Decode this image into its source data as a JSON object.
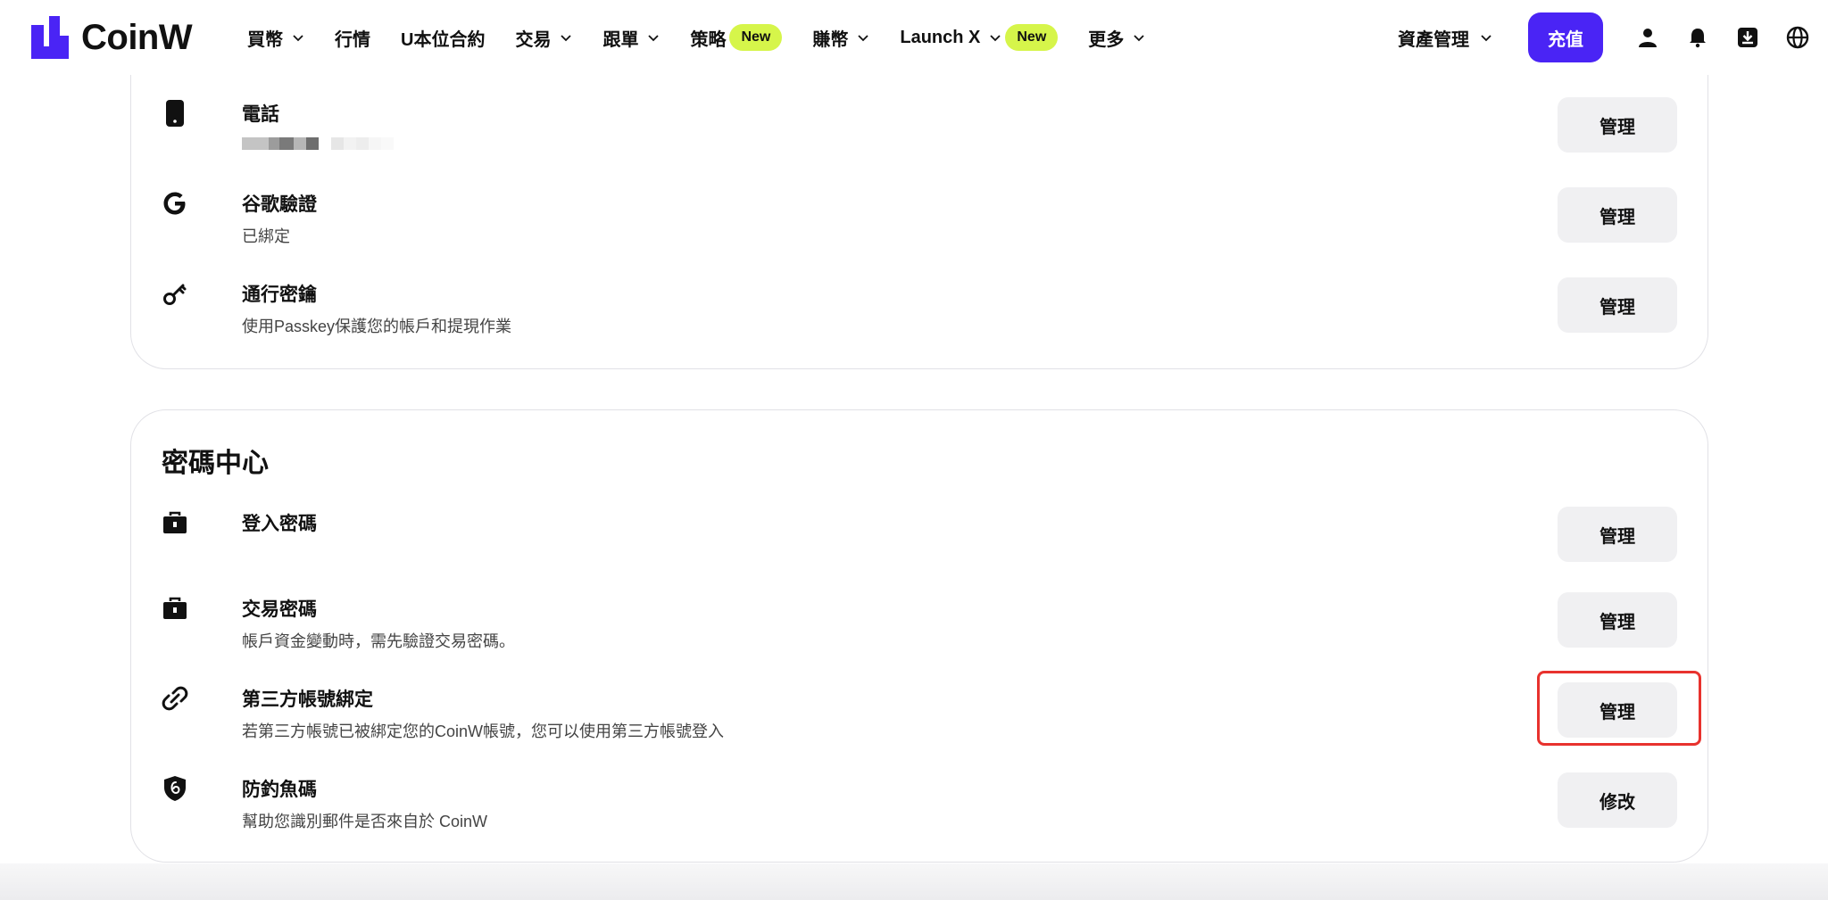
{
  "header": {
    "logo_text": "CoinW",
    "nav": [
      {
        "label": "買幣",
        "has_dropdown": true
      },
      {
        "label": "行情",
        "has_dropdown": false
      },
      {
        "label": "U本位合約",
        "has_dropdown": false
      },
      {
        "label": "交易",
        "has_dropdown": true
      },
      {
        "label": "跟單",
        "has_dropdown": true
      },
      {
        "label": "策略",
        "has_dropdown": false,
        "badge": "New"
      },
      {
        "label": "賺幣",
        "has_dropdown": true
      },
      {
        "label": "Launch X",
        "has_dropdown": true,
        "badge": "New"
      },
      {
        "label": "更多",
        "has_dropdown": true
      }
    ],
    "asset_management": "資產管理",
    "deposit": "充值",
    "icons": [
      "user-icon",
      "bell-icon",
      "download-icon",
      "globe-icon"
    ],
    "accent_color": "#4a24f5",
    "badge_color": "#d6f54a"
  },
  "security": {
    "items": [
      {
        "icon": "phone-icon",
        "title": "電話",
        "desc": "",
        "action": "管理"
      },
      {
        "icon": "google-icon",
        "title": "谷歌驗證",
        "desc": "已綁定",
        "action": "管理"
      },
      {
        "icon": "key-icon",
        "title": "通行密鑰",
        "desc": "使用Passkey保護您的帳戶和提現作業",
        "action": "管理"
      }
    ]
  },
  "password_center": {
    "title": "密碼中心",
    "items": [
      {
        "icon": "briefcase-icon",
        "title": "登入密碼",
        "desc": "",
        "action": "管理"
      },
      {
        "icon": "briefcase-icon",
        "title": "交易密碼",
        "desc": "帳戶資金變動時，需先驗證交易密碼。",
        "action": "管理"
      },
      {
        "icon": "link-icon",
        "title": "第三方帳號綁定",
        "desc": "若第三方帳號已被綁定您的CoinW帳號，您可以使用第三方帳號登入",
        "action": "管理"
      },
      {
        "icon": "shield-icon",
        "title": "防釣魚碼",
        "desc": "幫助您識別郵件是否來自於 CoinW",
        "action": "修改"
      }
    ]
  },
  "highlight_color": "#e8322e"
}
